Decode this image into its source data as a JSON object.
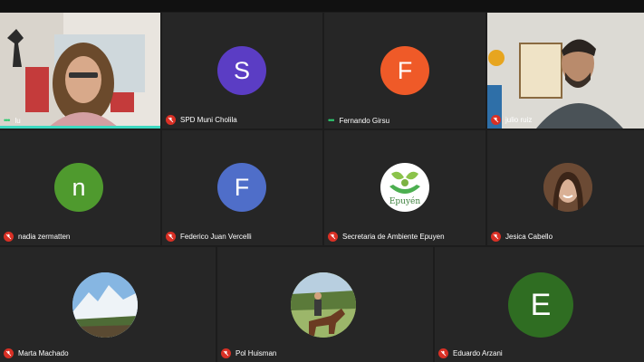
{
  "participants": [
    {
      "name": "lu",
      "avatar": "video"
    },
    {
      "name": "SPD Muni Cholila",
      "initial": "S",
      "color": "#5b3dc4"
    },
    {
      "name": "Fernando Girsu",
      "initial": "F",
      "color": "#ef5a28"
    },
    {
      "name": "julio ruiz",
      "avatar": "video"
    },
    {
      "name": "nadia zermatten",
      "initial": "n",
      "color": "#4f9a2e"
    },
    {
      "name": "Federico Juan Vercelli",
      "initial": "F",
      "color": "#4f6ec9"
    },
    {
      "name": "Secretaria de Ambiente Epuyen",
      "logo_text": "Epuyén"
    },
    {
      "name": "Jesica Cabello",
      "avatar": "photo"
    },
    {
      "name": "Marta Machado",
      "avatar": "photo"
    },
    {
      "name": "Pol Huisman",
      "avatar": "photo"
    },
    {
      "name": "Eduardo Arzani",
      "initial": "E",
      "color": "#2f6d22"
    }
  ],
  "colors": {
    "muted": "#d93025",
    "speaking": "#2ecc71",
    "active_border": "#3dd9c1"
  }
}
